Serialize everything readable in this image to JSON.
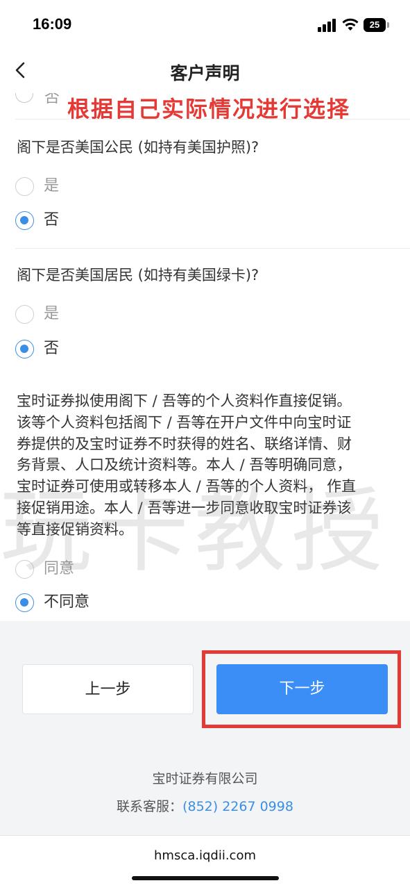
{
  "status_bar": {
    "time": "16:09",
    "battery": "25"
  },
  "nav": {
    "title": "客户声明"
  },
  "annotation": {
    "text": "根据自己实际情况进行选择"
  },
  "partial_option": {
    "label": "否"
  },
  "questions": [
    {
      "text": "阁下是否美国公民 (如持有美国护照)?",
      "options": [
        {
          "label": "是",
          "selected": false
        },
        {
          "label": "否",
          "selected": true
        }
      ]
    },
    {
      "text": "阁下是否美国居民 (如持有美国绿卡)?",
      "options": [
        {
          "label": "是",
          "selected": false
        },
        {
          "label": "否",
          "selected": true
        }
      ]
    }
  ],
  "consent": {
    "lines": [
      "宝时证券拟使用阁下 / 吾等的个人资料作直接促销。",
      "该等个人资料包括阁下 / 吾等在开户文件中向宝时证",
      "券提供的及宝时证券不时获得的姓名、联络详情、财",
      "务背景、人口及统计资料等。本人 / 吾等明确同意，",
      "宝时证券可使用或转移本人 / 吾等的个人资料， 作直",
      "接促销用途。本人 / 吾等进一步同意收取宝时证券该",
      "等直接促销资料。"
    ],
    "options": [
      {
        "label": "同意",
        "selected": false
      },
      {
        "label": "不同意",
        "selected": true
      }
    ]
  },
  "watermark": "玩卡教授",
  "buttons": {
    "prev": "上一步",
    "next": "下一步"
  },
  "footer": {
    "company": "宝时证券有限公司",
    "contact_label": "联系客服：",
    "phone": "(852) 2267 0998"
  },
  "browser": {
    "url": "hmsca.iqdii.com"
  }
}
